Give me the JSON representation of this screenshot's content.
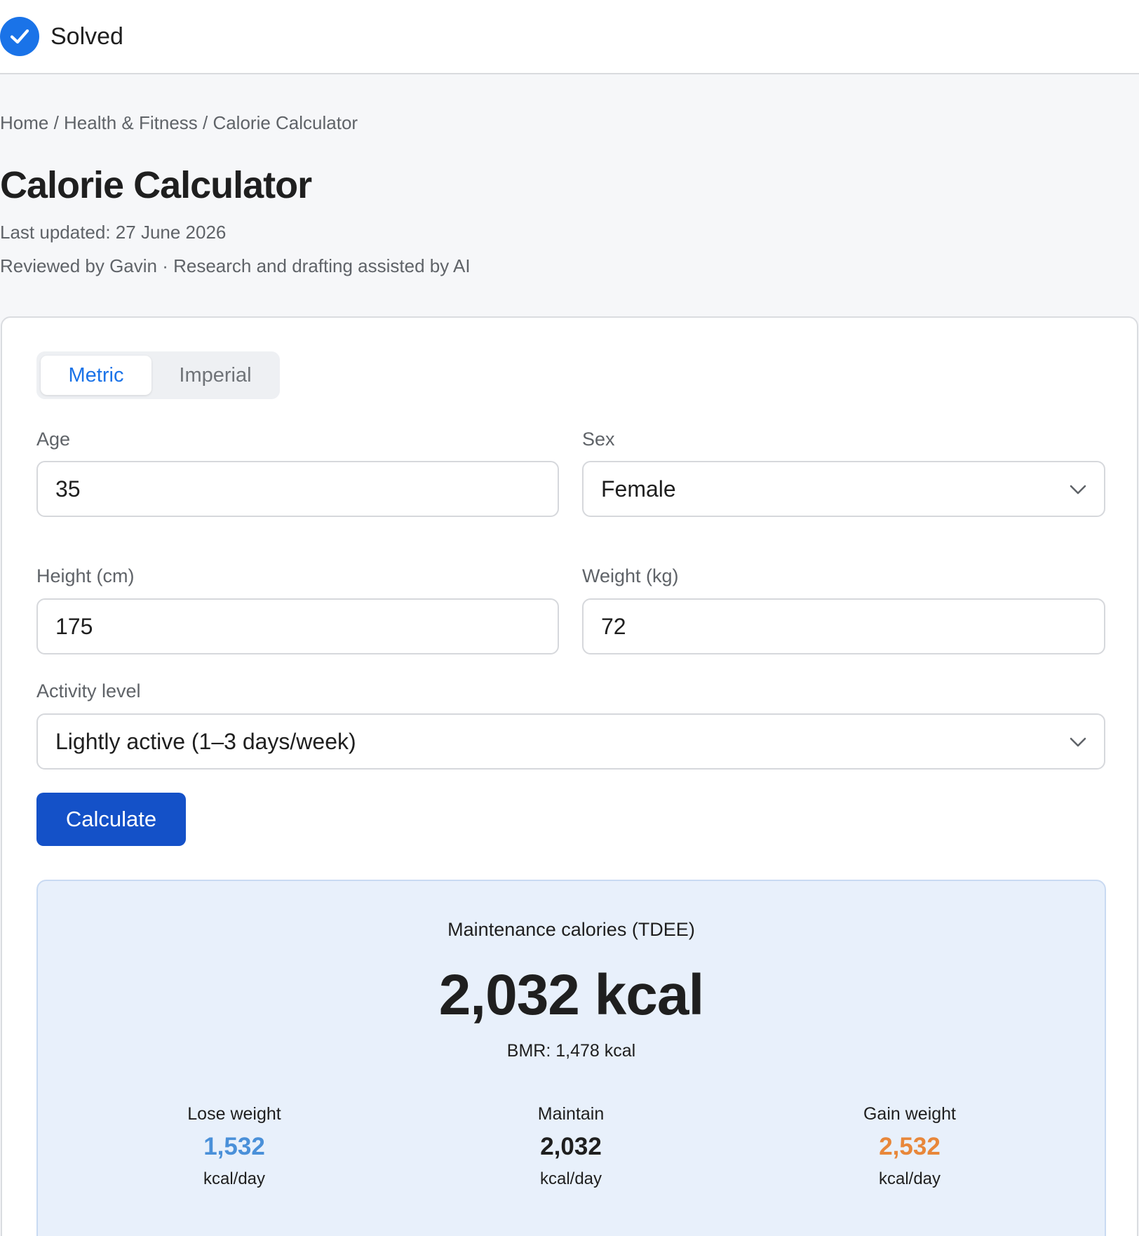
{
  "status": {
    "label": "Solved",
    "icon": "check-circle-icon",
    "color": "#1a73e8"
  },
  "breadcrumb": "Home / Health & Fitness / Calorie Calculator",
  "page": {
    "title": "Calorie Calculator",
    "last_updated": "Last updated: 27 June 2026",
    "reviewed": "Reviewed by Gavin · Research and drafting assisted by AI"
  },
  "units": {
    "metric_label": "Metric",
    "imperial_label": "Imperial",
    "selected": "Metric"
  },
  "form": {
    "age": {
      "label": "Age",
      "value": "35"
    },
    "sex": {
      "label": "Sex",
      "value": "Female"
    },
    "height": {
      "label": "Height (cm)",
      "value": "175"
    },
    "weight": {
      "label": "Weight (kg)",
      "value": "72"
    },
    "activity": {
      "label": "Activity level",
      "value": "Lightly active (1–3 days/week)"
    },
    "calculate_label": "Calculate"
  },
  "results": {
    "tdee_label": "Maintenance calories (TDEE)",
    "tdee_value": "2,032 kcal",
    "bmr": "BMR: 1,478 kcal",
    "goals": {
      "lose": {
        "label": "Lose weight",
        "value": "1,532",
        "unit": "kcal/day",
        "color": "#4a90d9"
      },
      "maintain": {
        "label": "Maintain",
        "value": "2,032",
        "unit": "kcal/day",
        "color": "#1f1f1f"
      },
      "gain": {
        "label": "Gain weight",
        "value": "2,532",
        "unit": "kcal/day",
        "color": "#e8873a"
      }
    }
  },
  "colors": {
    "accent": "#1a73e8",
    "button": "#1451c8",
    "results_bg": "#e8f0fb"
  }
}
